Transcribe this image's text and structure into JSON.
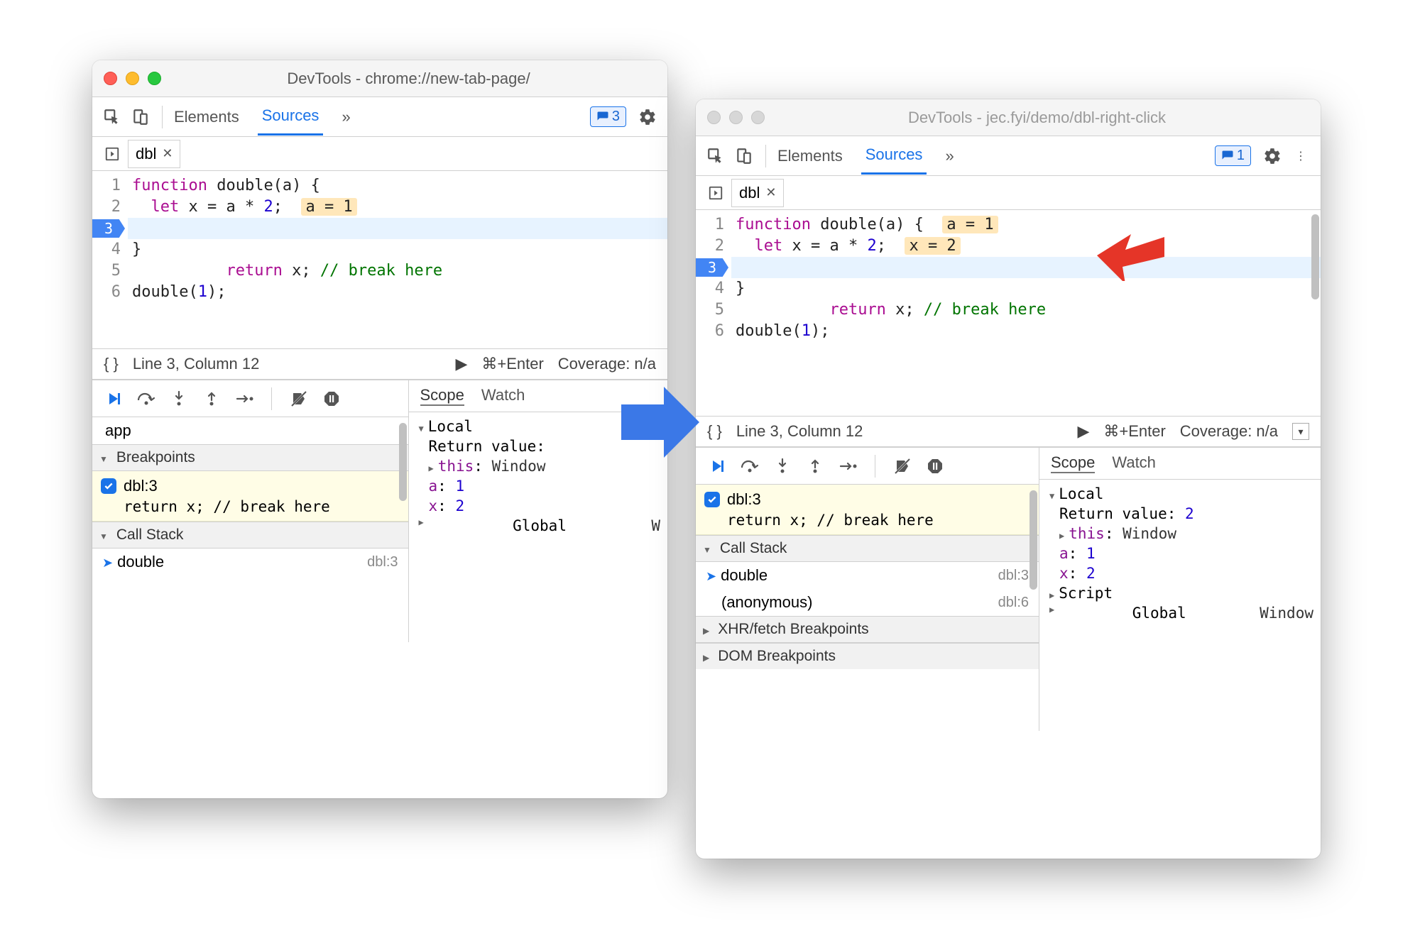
{
  "window1": {
    "title": "DevTools - chrome://new-tab-page/",
    "tabs": {
      "elements": "Elements",
      "sources": "Sources"
    },
    "issues_count": "3",
    "file_tab": "dbl",
    "breakpoint_line_label": "3",
    "code": {
      "lines": [
        "1",
        "2",
        "3",
        "4",
        "5",
        "6"
      ],
      "l1_a": "function",
      "l1_b": " double(a) {",
      "l2_a": "  let",
      "l2_b": " x = a * ",
      "l2_c": "2",
      "l2_d": ";",
      "l2_inline": "a = 1",
      "l3_a": "  return",
      "l3_b": " x; ",
      "l3_c": "// break here",
      "l4": "}",
      "l5": "",
      "l6_a": "double(",
      "l6_b": "1",
      "l6_c": ");"
    },
    "status": {
      "cursor": "Line 3, Column 12",
      "run": "⌘+Enter",
      "coverage": "Coverage: n/a"
    },
    "sidebar": {
      "app_row": "app",
      "breakpoints_hdr": "Breakpoints",
      "bp_label": "dbl:3",
      "bp_code": "return x; // break here",
      "callstack_hdr": "Call Stack",
      "call_fn": "double",
      "call_loc": "dbl:3"
    },
    "scope": {
      "tab_scope": "Scope",
      "tab_watch": "Watch",
      "local": "Local",
      "return_label": "Return value:",
      "this_label": "this",
      "this_val": "Window",
      "a_label": "a",
      "a_val": "1",
      "x_label": "x",
      "x_val": "2",
      "global": "Global",
      "global_val": "W"
    }
  },
  "window2": {
    "title": "DevTools - jec.fyi/demo/dbl-right-click",
    "tabs": {
      "elements": "Elements",
      "sources": "Sources"
    },
    "issues_count": "1",
    "file_tab": "dbl",
    "breakpoint_line_label": "3",
    "code": {
      "lines": [
        "1",
        "2",
        "3",
        "4",
        "5",
        "6"
      ],
      "l1_a": "function",
      "l1_b": " double(a) {",
      "l1_inline": "a = 1",
      "l2_a": "  let",
      "l2_b": " x = a * ",
      "l2_c": "2",
      "l2_d": ";",
      "l2_inline": "x = 2",
      "l3_a": "  return",
      "l3_b": " x; ",
      "l3_c": "// break here",
      "l4": "}",
      "l5": "",
      "l6_a": "double(",
      "l6_b": "1",
      "l6_c": ");"
    },
    "status": {
      "cursor": "Line 3, Column 12",
      "run": "⌘+Enter",
      "coverage": "Coverage: n/a"
    },
    "sidebar": {
      "bp_label": "dbl:3",
      "bp_code": "return x; // break here",
      "callstack_hdr": "Call Stack",
      "call_fn1": "double",
      "call_loc1": "dbl:3",
      "call_fn2": "(anonymous)",
      "call_loc2": "dbl:6",
      "xhr_hdr": "XHR/fetch Breakpoints",
      "dom_hdr": "DOM Breakpoints"
    },
    "scope": {
      "tab_scope": "Scope",
      "tab_watch": "Watch",
      "local": "Local",
      "return_label": "Return value:",
      "return_val": "2",
      "this_label": "this",
      "this_val": "Window",
      "a_label": "a",
      "a_val": "1",
      "x_label": "x",
      "x_val": "2",
      "script": "Script",
      "global": "Global",
      "global_val": "Window"
    }
  }
}
